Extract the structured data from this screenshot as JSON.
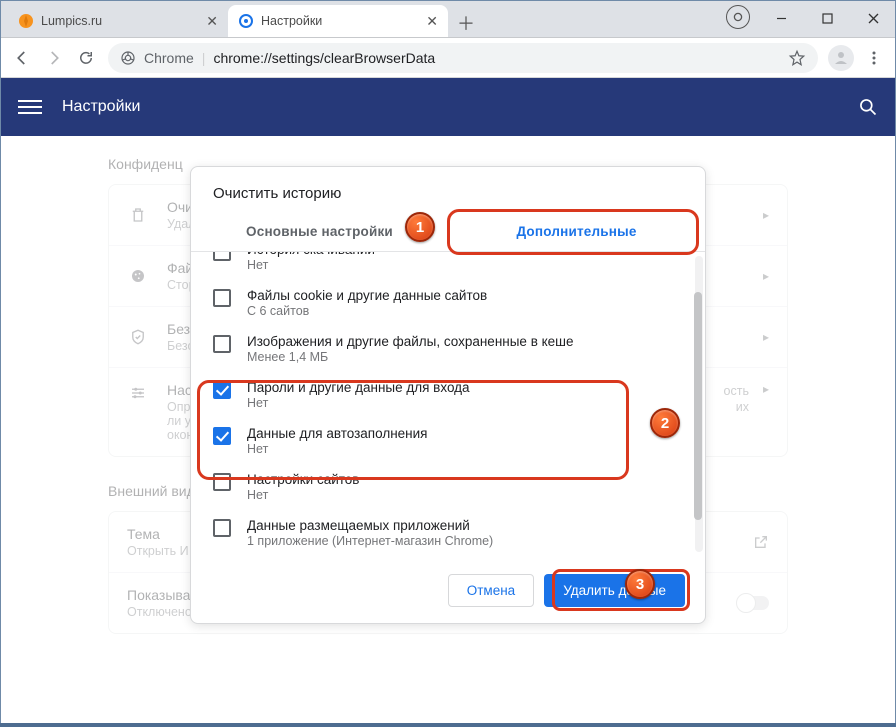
{
  "window": {
    "tabs": [
      {
        "title": "Lumpics.ru",
        "favicon": "orange"
      },
      {
        "title": "Настройки",
        "favicon": "gear"
      }
    ],
    "controls": {
      "min": "—",
      "max": "▢",
      "close": "✕"
    }
  },
  "toolbar": {
    "chrome_label": "Chrome",
    "url_path": "chrome://settings/clearBrowserData"
  },
  "header": {
    "title": "Настройки"
  },
  "page": {
    "section1_title": "Конфиденц",
    "rows": [
      {
        "icon": "trash",
        "title": "Очис",
        "sub": "Удал"
      },
      {
        "icon": "cookie",
        "title": "Файл",
        "sub": "Стор"
      },
      {
        "icon": "shield",
        "title": "Безо",
        "sub": "Безо"
      },
      {
        "icon": "sliders",
        "title": "Наст",
        "sub": "Опре\nли у\nокон",
        "multi": true
      }
    ],
    "section2_title": "Внешний вид",
    "theme_row": {
      "title": "Тема",
      "sub": "Открыть И"
    },
    "home_row": {
      "title": "Показывать кнопку \"Главная страница\"",
      "sub": "Отключено"
    }
  },
  "dialog": {
    "title": "Очистить историю",
    "tab_basic": "Основные настройки",
    "tab_advanced": "Дополнительные",
    "options": [
      {
        "checked": false,
        "title": "История скачиваний",
        "sub": "Нет",
        "clipped": true
      },
      {
        "checked": false,
        "title": "Файлы cookie и другие данные сайтов",
        "sub": "С 6 сайтов"
      },
      {
        "checked": false,
        "title": "Изображения и другие файлы, сохраненные в кеше",
        "sub": "Менее 1,4 МБ"
      },
      {
        "checked": true,
        "title": "Пароли и другие данные для входа",
        "sub": "Нет"
      },
      {
        "checked": true,
        "title": "Данные для автозаполнения",
        "sub": "Нет"
      },
      {
        "checked": false,
        "title": "Настройки сайтов",
        "sub": "Нет"
      },
      {
        "checked": false,
        "title": "Данные размещаемых приложений",
        "sub": "1 приложение (Интернет-магазин Chrome)"
      }
    ],
    "cancel": "Отмена",
    "confirm": "Удалить данные"
  },
  "markers": {
    "m1": "1",
    "m2": "2",
    "m3": "3"
  },
  "settings_rows_extra": {
    "sub2": "ость",
    "sub3": "их"
  }
}
